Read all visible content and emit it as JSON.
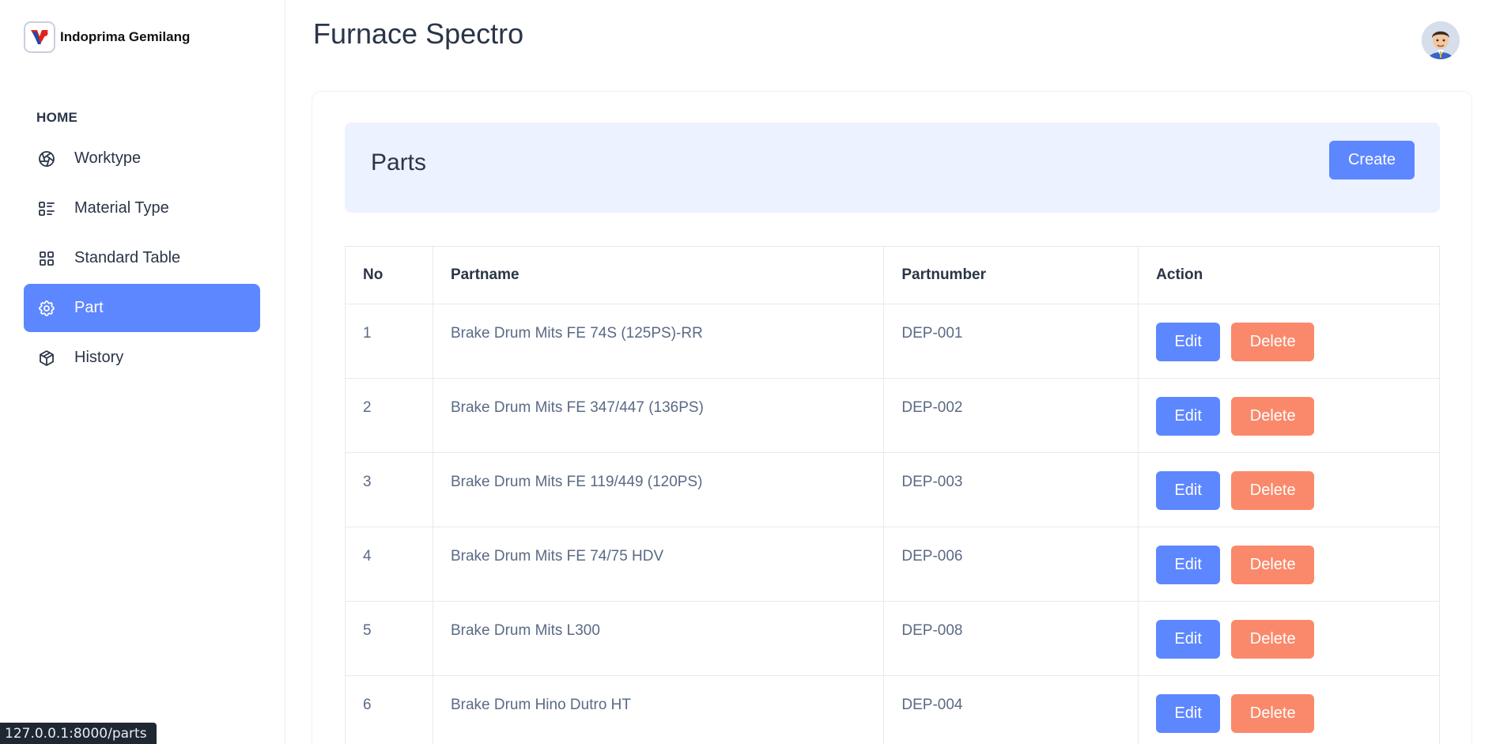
{
  "brand": {
    "name": "Indoprima Gemilang",
    "logo_icon": "indoprima-logo-icon"
  },
  "sidebar": {
    "section_label": "HOME",
    "items": [
      {
        "label": "Worktype",
        "icon": "aperture-icon",
        "active": false
      },
      {
        "label": "Material Type",
        "icon": "list-details-icon",
        "active": false
      },
      {
        "label": "Standard Table",
        "icon": "layout-grid-icon",
        "active": false
      },
      {
        "label": "Part",
        "icon": "settings-icon",
        "active": true
      },
      {
        "label": "History",
        "icon": "box-icon",
        "active": false
      }
    ]
  },
  "header": {
    "title": "Furnace Spectro",
    "avatar": "user-avatar"
  },
  "card": {
    "title": "Parts",
    "create_label": "Create",
    "table": {
      "columns": [
        "No",
        "Partname",
        "Partnumber",
        "Action"
      ],
      "rows": [
        {
          "no": "1",
          "partname": "Brake Drum Mits FE 74S (125PS)-RR",
          "partnumber": "DEP-001"
        },
        {
          "no": "2",
          "partname": "Brake Drum Mits FE 347/447 (136PS)",
          "partnumber": "DEP-002"
        },
        {
          "no": "3",
          "partname": "Brake Drum Mits FE 119/449 (120PS)",
          "partnumber": "DEP-003"
        },
        {
          "no": "4",
          "partname": "Brake Drum Mits FE 74/75 HDV",
          "partnumber": "DEP-006"
        },
        {
          "no": "5",
          "partname": "Brake Drum Mits L300",
          "partnumber": "DEP-008"
        },
        {
          "no": "6",
          "partname": "Brake Drum Hino Dutro HT",
          "partnumber": "DEP-004"
        }
      ],
      "edit_label": "Edit",
      "delete_label": "Delete"
    }
  },
  "status_bar": {
    "url": "127.0.0.1:8000/parts"
  },
  "colors": {
    "primary": "#5d87ff",
    "danger": "#fa896b",
    "header_bg": "#ecf2ff",
    "text": "#2a3547",
    "muted_text": "#5a6a85"
  }
}
